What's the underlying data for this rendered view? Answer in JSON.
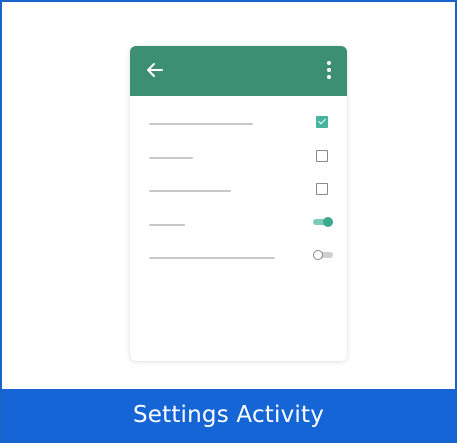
{
  "template": {
    "caption": "Settings Activity"
  },
  "preview": {
    "appbar": {
      "back_icon": "arrow-left-icon",
      "menu_icon": "more-vert-icon"
    },
    "rows": [
      {
        "control": "checkbox",
        "state": "checked"
      },
      {
        "control": "checkbox",
        "state": "unchecked"
      },
      {
        "control": "checkbox",
        "state": "unchecked"
      },
      {
        "control": "switch",
        "state": "on"
      },
      {
        "control": "switch",
        "state": "off"
      }
    ]
  },
  "colors": {
    "caption_bar": "#1565d6",
    "appbar": "#3c8f72",
    "accent": "#46b49e"
  }
}
